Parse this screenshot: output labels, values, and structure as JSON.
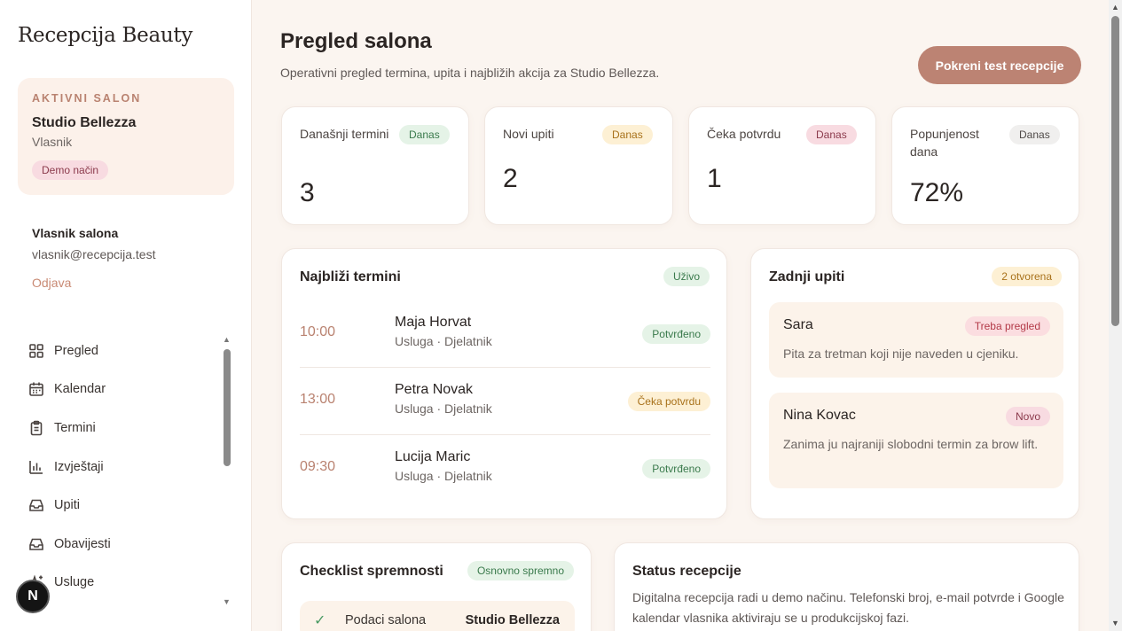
{
  "sidebar": {
    "brand": "Recepcija Beauty",
    "salon_card": {
      "kicker": "AKTIVNI SALON",
      "name": "Studio Bellezza",
      "role": "Vlasnik",
      "mode_badge": "Demo način"
    },
    "user": {
      "name": "Vlasnik salona",
      "email": "vlasnik@recepcija.test",
      "logout": "Odjava"
    },
    "nav": [
      {
        "label": "Pregled",
        "icon": "grid-icon"
      },
      {
        "label": "Kalendar",
        "icon": "calendar-icon"
      },
      {
        "label": "Termini",
        "icon": "clipboard-icon"
      },
      {
        "label": "Izvještaji",
        "icon": "bar-chart-icon"
      },
      {
        "label": "Upiti",
        "icon": "inbox-icon"
      },
      {
        "label": "Obavijesti",
        "icon": "inbox-icon"
      },
      {
        "label": "Usluge",
        "icon": "sparkle-icon"
      }
    ],
    "avatar_letter": "N"
  },
  "header": {
    "title": "Pregled salona",
    "subtitle": "Operativni pregled termina, upita i najbližih akcija za Studio Bellezza.",
    "primary_button": "Pokreni test recepcije"
  },
  "stats": [
    {
      "label": "Današnji termini",
      "badge": "Danas",
      "value": "3"
    },
    {
      "label": "Novi upiti",
      "badge": "Danas",
      "value": "2"
    },
    {
      "label": "Čeka potvrdu",
      "badge": "Danas",
      "value": "1"
    },
    {
      "label": "Popunjenost dana",
      "badge": "Danas",
      "value": "72%"
    }
  ],
  "appointments": {
    "title": "Najbliži termini",
    "badge": "Uživo",
    "items": [
      {
        "time": "10:00",
        "name": "Maja Horvat",
        "meta": "Usluga · Djelatnik",
        "status": "Potvrđeno"
      },
      {
        "time": "13:00",
        "name": "Petra Novak",
        "meta": "Usluga · Djelatnik",
        "status": "Čeka potvrdu"
      },
      {
        "time": "09:30",
        "name": "Lucija Maric",
        "meta": "Usluga · Djelatnik",
        "status": "Potvrđeno"
      }
    ]
  },
  "inquiries": {
    "title": "Zadnji upiti",
    "badge": "2 otvorena",
    "items": [
      {
        "name": "Sara",
        "tag": "Treba pregled",
        "text": "Pita za tretman koji nije naveden u cjeniku."
      },
      {
        "name": "Nina Kovac",
        "tag": "Novo",
        "text": "Zanima ju najraniji slobodni termin za brow lift."
      }
    ]
  },
  "checklist": {
    "title": "Checklist spremnosti",
    "badge": "Osnovno spremno",
    "rows": [
      {
        "label": "Podaci salona",
        "value": "Studio Bellezza"
      }
    ]
  },
  "status": {
    "title": "Status recepcije",
    "text": "Digitalna recepcija radi u demo načinu. Telefonski broj, e-mail potvrde i Google kalendar vlasnika aktiviraju se u produkcijskoj fazi."
  },
  "colors": {
    "accent": "#bc8373",
    "background": "#fbf5f0",
    "success": "#3a7a4c",
    "warning": "#a8711a"
  }
}
